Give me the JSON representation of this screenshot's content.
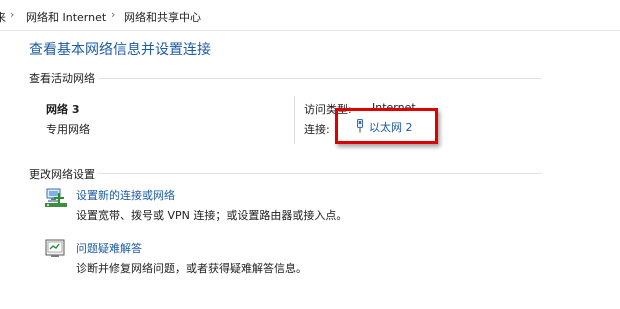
{
  "breadcrumb": {
    "items": [
      "来",
      "网络和 Internet",
      "网络和共享中心"
    ],
    "separator": "›"
  },
  "page": {
    "title": "查看基本网络信息并设置连接"
  },
  "active_networks": {
    "header": "查看活动网络",
    "network": {
      "name": "网络 3",
      "type": "专用网络",
      "access_type_label": "访问类型:",
      "access_type_value": "Internet",
      "connections_label": "连接:",
      "connection_name": "以太网 2",
      "connection_icon": "ethernet-icon"
    }
  },
  "change_settings": {
    "header": "更改网络设置",
    "tasks": [
      {
        "icon": "network-setup-icon",
        "link": "设置新的连接或网络",
        "description": "设置宽带、拨号或 VPN 连接；或设置路由器或接入点。"
      },
      {
        "icon": "troubleshoot-icon",
        "link": "问题疑难解答",
        "description": "诊断并修复网络问题，或者获得疑难解答信息。"
      }
    ]
  },
  "colors": {
    "link": "#1c5ba5",
    "highlight": "#e00000"
  }
}
